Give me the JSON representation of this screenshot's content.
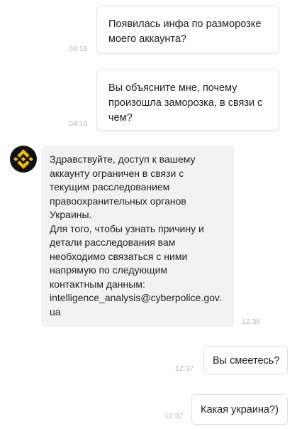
{
  "messages": [
    {
      "text": "Появилась инфа по разморозке моего аккаунта?",
      "time": "04:18"
    },
    {
      "text": "Вы объясните мне, почему произошла заморозка, в связи с чем?",
      "time": "04:18"
    },
    {
      "text": "Здравствуйте, доступ к вашему\nаккаунту ограничен в связи с\nтекущим расследованием\nправоохранительных органов\nУкраины.\nДля того, чтобы узнать причину и\nдетали расследования вам\nнеобходимо связаться с ними\nнапрямую по следующим\nконтактным данным:",
      "email": "intelligence_analysis@cyberpolice.gov.\nua",
      "time": "12:36"
    },
    {
      "text": "Вы смеетесь?",
      "time": "12:37"
    },
    {
      "text": "Какая украина?)",
      "time": "12:37"
    }
  ],
  "colors": {
    "incoming_bg": "#f2f2f2",
    "outgoing_bg": "#ffffff",
    "avatar_bg": "#111111",
    "avatar_icon": "#f0b90b",
    "timestamp": "#b4b4b4"
  },
  "avatar": {
    "icon": "binance-logo-icon"
  }
}
